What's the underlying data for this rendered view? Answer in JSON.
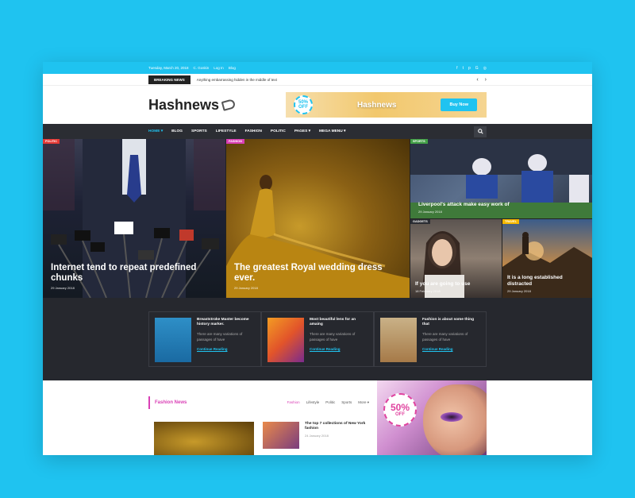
{
  "topbar": {
    "date": "Tuesday, March 20, 2018",
    "location": "C. Goskin",
    "login": "Log In",
    "blog": "Blog",
    "social_icons": [
      "facebook-icon",
      "twitter-icon",
      "pinterest-icon",
      "googleplus-icon",
      "instagram-icon"
    ]
  },
  "breaking": {
    "label": "BREAKING NEWS",
    "text": "Anything embarrassing hidden in the middle of text",
    "prev": "‹",
    "next": "›"
  },
  "header": {
    "logo": "Hashnews",
    "banner": {
      "discount": "50%",
      "discount_off": "OFF",
      "name": "Hashnews",
      "button": "Buy Now"
    }
  },
  "nav": {
    "items": [
      "HOME ▾",
      "BLOG",
      "SPORTS",
      "LIFESTYLE",
      "FASHION",
      "POLITIC",
      "PAGES ▾",
      "MEGA MENU ▾"
    ],
    "active_index": 0
  },
  "hero": {
    "cards": [
      {
        "tag": "POLITIC",
        "tag_color": "#e53935",
        "title": "Internet tend to repeat predefined chunks",
        "date": "29 January 2018"
      },
      {
        "tag": "FASHION",
        "tag_color": "#d93fb5",
        "title": "The greatest Royal wedding dress ever.",
        "date": "29 January 2018"
      },
      {
        "tag": "SPORTS",
        "tag_color": "#43a047",
        "title": "Liverpool's attack make easy work of",
        "date": "29 January 2018"
      },
      {
        "tag": "GADGETS",
        "tag_color": "#2b2d33",
        "title": "If you are going to use",
        "date": "18 February 2018"
      },
      {
        "tag": "TRAVEL",
        "tag_color": "#f5b800",
        "title": "It is a long established distracted",
        "date": "29 January 2018"
      }
    ]
  },
  "features": [
    {
      "title": "Breaststroke Master become history marker.",
      "text": "There are many variations of passages of have",
      "more": "Continue Reading"
    },
    {
      "title": "Most beautiful lens for an amaing",
      "text": "There are many variations of passages of have",
      "more": "Continue Reading"
    },
    {
      "title": "Fashion is about some thing that",
      "text": "There are many variations of passages of have",
      "more": "Continue Reading"
    }
  ],
  "fashion_news": {
    "title": "Fashion News",
    "tabs": [
      "Fashion",
      "Lifestyle",
      "Politic",
      "Sports",
      "More ▾"
    ],
    "active_tab": 0,
    "article": {
      "title": "The top 7 collections of New York fashion",
      "date": "24 January 2018"
    }
  },
  "ad": {
    "percent": "50%",
    "off": "OFF"
  },
  "colors": {
    "accent": "#1fc3f0",
    "fashion": "#d93fb5",
    "dark": "#26282e"
  }
}
